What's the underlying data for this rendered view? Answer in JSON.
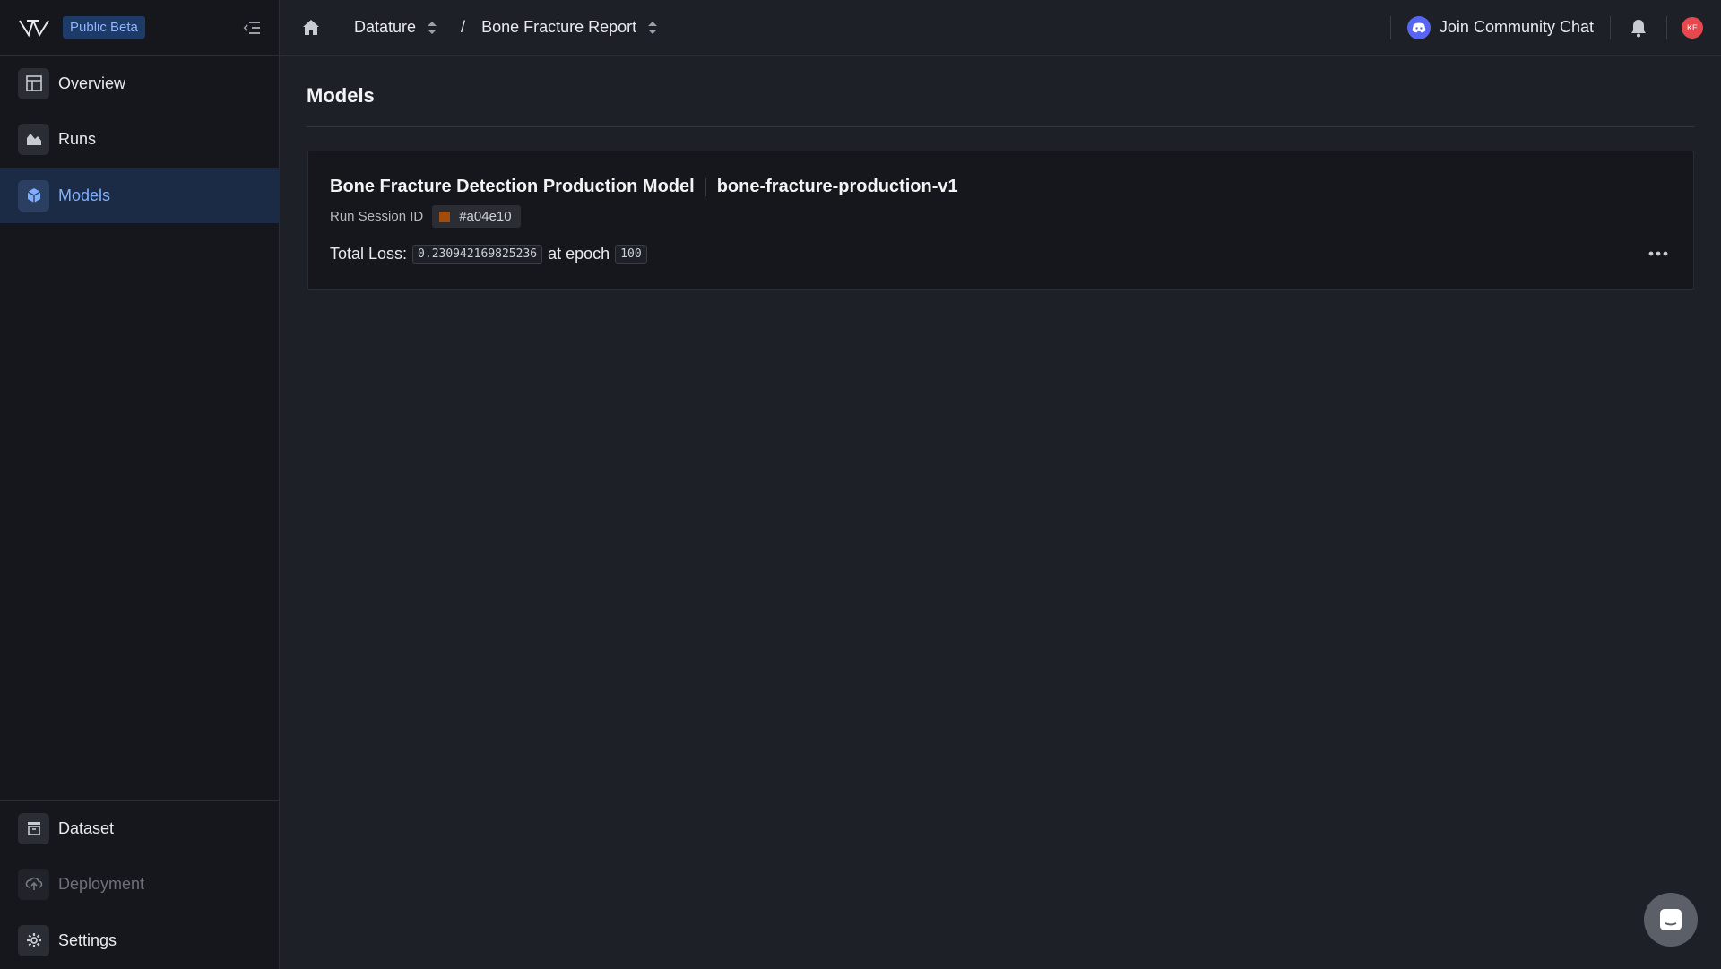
{
  "app": {
    "beta_badge": "Public Beta",
    "logo_icon": "vi-logo-icon",
    "accent": "#7fb0ff",
    "brand_blue": "#1e3a66"
  },
  "sidebar": {
    "items": [
      {
        "label": "Overview",
        "icon": "layout-icon"
      },
      {
        "label": "Runs",
        "icon": "area-chart-icon"
      },
      {
        "label": "Models",
        "icon": "cube-icon",
        "active": true
      }
    ],
    "bottom_items": [
      {
        "label": "Dataset",
        "icon": "archive-icon"
      },
      {
        "label": "Deployment",
        "icon": "cloud-upload-icon",
        "disabled": true
      },
      {
        "label": "Settings",
        "icon": "gear-icon"
      }
    ]
  },
  "header": {
    "breadcrumb": [
      {
        "label": "Datature"
      },
      {
        "label": "Bone Fracture Report"
      }
    ],
    "separator": "/",
    "community_label": "Join Community Chat",
    "avatar_initials": "KE",
    "avatar_color": "#e5484d"
  },
  "main": {
    "title": "Models",
    "models": [
      {
        "name": "Bone Fracture Detection Production Model",
        "id": "bone-fracture-production-v1",
        "session_label": "Run Session ID",
        "session_id": "#a04e10",
        "session_color": "#a04e10",
        "loss_prefix": "Total Loss:",
        "loss_value": "0.230942169825236",
        "epoch_prefix": "at epoch",
        "epoch_value": "100"
      }
    ]
  }
}
